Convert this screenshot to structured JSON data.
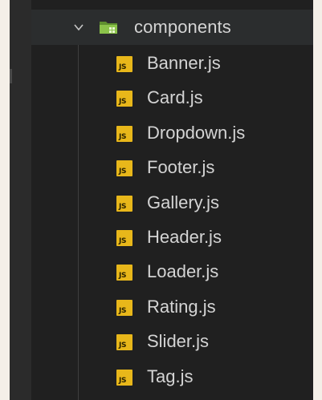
{
  "explorer": {
    "folder": {
      "name": "components",
      "expanded": true,
      "icon": "folder-components-icon",
      "chevron": "chevron-down-icon"
    },
    "files": [
      {
        "name": "Banner.js",
        "icon_text": "JS"
      },
      {
        "name": "Card.js",
        "icon_text": "JS"
      },
      {
        "name": "Dropdown.js",
        "icon_text": "JS"
      },
      {
        "name": "Footer.js",
        "icon_text": "JS"
      },
      {
        "name": "Gallery.js",
        "icon_text": "JS"
      },
      {
        "name": "Header.js",
        "icon_text": "JS"
      },
      {
        "name": "Loader.js",
        "icon_text": "JS"
      },
      {
        "name": "Rating.js",
        "icon_text": "JS"
      },
      {
        "name": "Slider.js",
        "icon_text": "JS"
      },
      {
        "name": "Tag.js",
        "icon_text": "JS"
      }
    ]
  },
  "colors": {
    "explorer_bg": "#202020",
    "folder_row_bg": "#2b2d2e",
    "text": "#d4d4d4",
    "js_icon": "#e8b71a",
    "folder_icon": "#8bc34a"
  }
}
